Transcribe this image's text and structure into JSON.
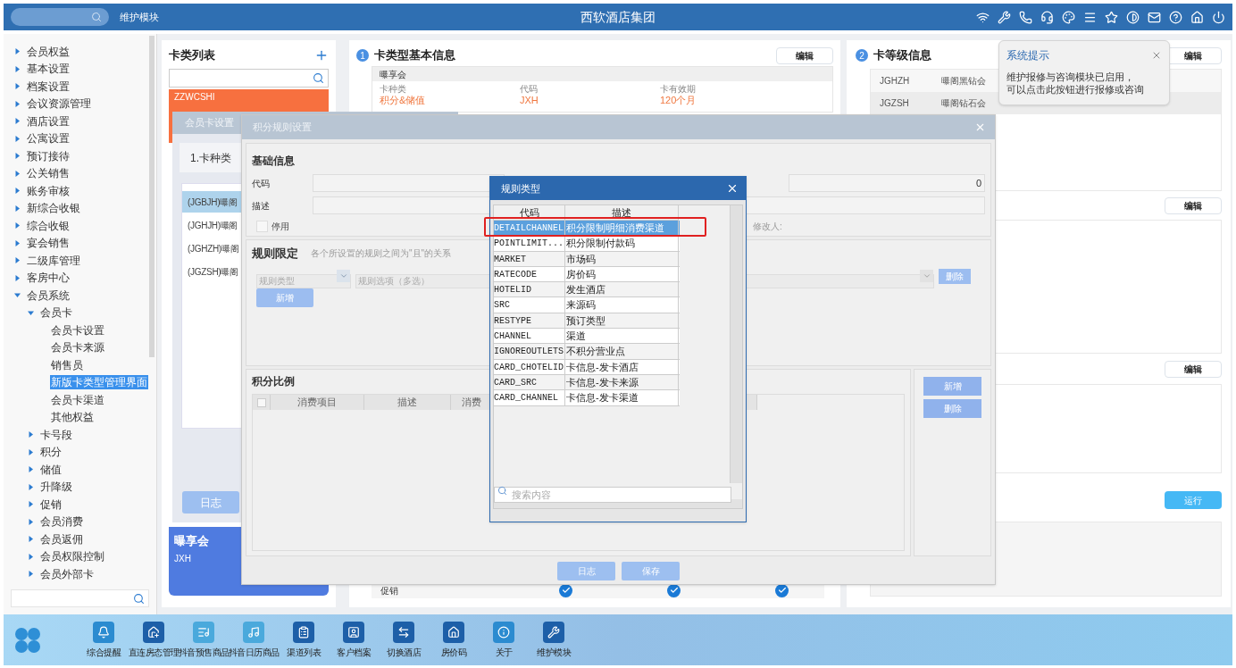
{
  "header": {
    "module": "维护模块",
    "title": "西软酒店集团"
  },
  "sidebar": {
    "items": [
      {
        "label": "会员权益",
        "expanded": false,
        "selected": false
      },
      {
        "label": "基本设置",
        "expanded": false,
        "selected": false
      },
      {
        "label": "档案设置",
        "expanded": false,
        "selected": false
      },
      {
        "label": "会议资源管理",
        "expanded": false,
        "selected": false
      },
      {
        "label": "酒店设置",
        "expanded": false,
        "selected": false
      },
      {
        "label": "公寓设置",
        "expanded": false,
        "selected": false
      },
      {
        "label": "预订接待",
        "expanded": false,
        "selected": false
      },
      {
        "label": "公关销售",
        "expanded": false,
        "selected": false
      },
      {
        "label": "账务审核",
        "expanded": false,
        "selected": false
      },
      {
        "label": "新综合收银",
        "expanded": false,
        "selected": false
      },
      {
        "label": "综合收银",
        "expanded": false,
        "selected": false
      },
      {
        "label": "宴会销售",
        "expanded": false,
        "selected": false
      },
      {
        "label": "二级库管理",
        "expanded": false,
        "selected": false
      },
      {
        "label": "客房中心",
        "expanded": false,
        "selected": false
      },
      {
        "label": "会员系统",
        "expanded": true,
        "selected": false,
        "children": [
          {
            "label": "会员卡",
            "expanded": true,
            "selected": false,
            "children": [
              {
                "label": "会员卡设置",
                "selected": false
              },
              {
                "label": "会员卡来源",
                "selected": false
              },
              {
                "label": "销售员",
                "selected": false
              },
              {
                "label": "新版卡类型管理界面",
                "selected": true
              },
              {
                "label": "会员卡渠道",
                "selected": false
              },
              {
                "label": "其他权益",
                "selected": false
              }
            ]
          },
          {
            "label": "卡号段",
            "expanded": false,
            "selected": false
          },
          {
            "label": "积分",
            "expanded": false,
            "selected": false
          },
          {
            "label": "储值",
            "expanded": false,
            "selected": false
          },
          {
            "label": "升降级",
            "expanded": false,
            "selected": false
          },
          {
            "label": "促销",
            "expanded": false,
            "selected": false
          },
          {
            "label": "会员消费",
            "expanded": false,
            "selected": false
          },
          {
            "label": "会员返佣",
            "expanded": false,
            "selected": false
          },
          {
            "label": "会员权限控制",
            "expanded": false,
            "selected": false
          },
          {
            "label": "会员外部卡",
            "expanded": false,
            "selected": false
          }
        ]
      }
    ]
  },
  "card_list": {
    "title": "卡类列表",
    "cards": [
      {
        "code": "ZZWCSHI",
        "color": "#f7703f"
      },
      {
        "name": "曝享会",
        "code": "JXH",
        "color": "#4f7be0"
      }
    ]
  },
  "basic_info": {
    "step": "1",
    "title": "卡类型基本信息",
    "edit": "编辑",
    "card_name": "曝享会",
    "fields": [
      {
        "label": "卡种类",
        "value": "积分&储值"
      },
      {
        "label": "代码",
        "value": "JXH"
      },
      {
        "label": "卡有效期",
        "value": "120个月"
      }
    ],
    "bottom_row": {
      "label": "促销",
      "checks": [
        {
          "checked": true
        },
        {
          "checked": true
        },
        {
          "checked": true
        }
      ]
    }
  },
  "level_info": {
    "step": "2",
    "title": "卡等级信息",
    "edit": "编辑",
    "levels": [
      {
        "code": "JGHZH",
        "name": "曝阁黑钻会"
      },
      {
        "code": "JGZSH",
        "name": "曝阁钻石会"
      }
    ],
    "edit_2": "编辑",
    "edit_3": "编辑",
    "run": "运行"
  },
  "tooltip": {
    "title": "系统提示",
    "lines": [
      "维护报修与咨询模块已启用，",
      "可以点击此按钮进行报修或咨询"
    ]
  },
  "card_settings_dialog": {
    "title": "会员卡设置",
    "step_tab": "1.卡种类",
    "items": [
      {
        "label": "(JGBJH)曝阁",
        "selected": true
      },
      {
        "label": "(JGHJH)曝阁",
        "selected": false
      },
      {
        "label": "(JGHZH)曝阁",
        "selected": false
      },
      {
        "label": "(JGZSH)曝阁",
        "selected": false
      }
    ],
    "log_button": "日志"
  },
  "rule_dialog": {
    "title": "积分规则设置",
    "basic": {
      "title": "基础信息",
      "code_label": "代码",
      "desc_label": "描述",
      "number": "0",
      "disabled": {
        "label": "停用",
        "checked": false
      },
      "modifier_label": "修改人:"
    },
    "limits": {
      "title": "规则限定",
      "hint": "各个所设置的规则之间为\"且\"的关系",
      "type_placeholder": "规则类型",
      "options_placeholder": "规则选项（多选）",
      "delete": "删除",
      "add": "新增"
    },
    "ratio": {
      "title": "积分比例",
      "all_checked": false,
      "columns": [
        "消费项目",
        "描述",
        "消费"
      ],
      "add": "新增",
      "delete": "删除"
    },
    "footer": [
      "日志",
      "保存"
    ]
  },
  "rule_type_dialog": {
    "title": "规则类型",
    "columns": [
      "代码",
      "描述"
    ],
    "rows": [
      {
        "code": "DETAILCHANNEL",
        "desc": "积分限制明细消费渠道",
        "selected": true,
        "marked": true
      },
      {
        "code": "POINTLIMIT...",
        "desc": "积分限制付款码",
        "selected": false,
        "marked": false
      },
      {
        "code": "MARKET",
        "desc": "市场码",
        "selected": false,
        "marked": false
      },
      {
        "code": "RATECODE",
        "desc": "房价码",
        "selected": false,
        "marked": false
      },
      {
        "code": "HOTELID",
        "desc": "发生酒店",
        "selected": false,
        "marked": false
      },
      {
        "code": "SRC",
        "desc": "来源码",
        "selected": false,
        "marked": false
      },
      {
        "code": "RESTYPE",
        "desc": "预订类型",
        "selected": false,
        "marked": false
      },
      {
        "code": "CHANNEL",
        "desc": "渠道",
        "selected": false,
        "marked": false
      },
      {
        "code": "IGNOREOUTLETS",
        "desc": "不积分营业点",
        "selected": false,
        "marked": false
      },
      {
        "code": "CARD_CHOTELID",
        "desc": "卡信息-发卡酒店",
        "selected": false,
        "marked": false
      },
      {
        "code": "CARD_SRC",
        "desc": "卡信息-发卡来源",
        "selected": false,
        "marked": false
      },
      {
        "code": "CARD_CHANNEL",
        "desc": "卡信息-发卡渠道",
        "selected": false,
        "marked": false
      }
    ],
    "search": {
      "placeholder": "搜索内容"
    }
  },
  "taskbar": {
    "items": [
      {
        "kind": "bell",
        "label": "综合提醒"
      },
      {
        "kind": "house-gear",
        "label": "直连房态管理"
      },
      {
        "kind": "list-music",
        "label": "抖音预售商品"
      },
      {
        "kind": "music",
        "label": "抖音日历商品"
      },
      {
        "kind": "clipboard",
        "label": "渠道列表"
      },
      {
        "kind": "contact",
        "label": "客户档案"
      },
      {
        "kind": "swap",
        "label": "切换酒店"
      },
      {
        "kind": "house",
        "label": "房价码"
      },
      {
        "kind": "info",
        "label": "关于"
      },
      {
        "kind": "wrench",
        "label": "维护模块"
      }
    ]
  }
}
